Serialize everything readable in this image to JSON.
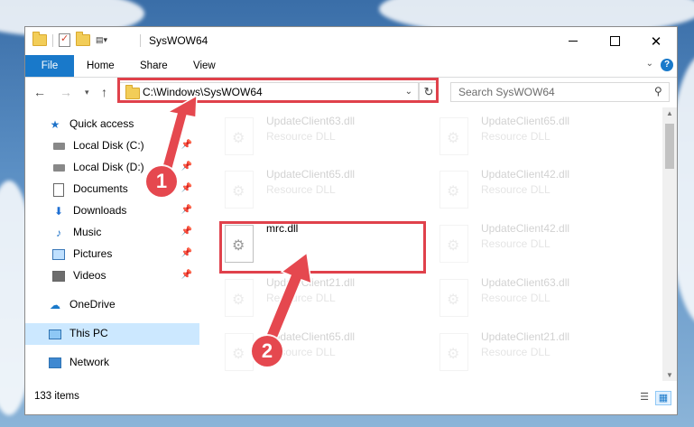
{
  "window": {
    "title": "SysWOW64"
  },
  "ribbon": {
    "tabs": [
      "File",
      "Home",
      "Share",
      "View"
    ],
    "help_label": "?"
  },
  "address_bar": {
    "path": "C:\\Windows\\SysWOW64",
    "search_placeholder": "Search SysWOW64"
  },
  "nav_pane": {
    "items": [
      {
        "label": "Quick access",
        "icon": "star-icon"
      },
      {
        "label": "Local Disk (C:)",
        "icon": "disk-icon",
        "pinned": true
      },
      {
        "label": "Local Disk (D:)",
        "icon": "disk-icon",
        "pinned": true
      },
      {
        "label": "Documents",
        "icon": "documents-icon",
        "pinned": true
      },
      {
        "label": "Downloads",
        "icon": "download-icon",
        "pinned": true
      },
      {
        "label": "Music",
        "icon": "music-icon",
        "pinned": true
      },
      {
        "label": "Pictures",
        "icon": "pictures-icon",
        "pinned": true
      },
      {
        "label": "Videos",
        "icon": "videos-icon",
        "pinned": true
      },
      {
        "label": "OneDrive",
        "icon": "cloud-icon"
      },
      {
        "label": "This PC",
        "icon": "computer-icon",
        "selected": true
      },
      {
        "label": "Network",
        "icon": "network-icon"
      }
    ]
  },
  "files": [
    {
      "name": "UpdateClient63.dll",
      "type": "Resource DLL",
      "faded": true
    },
    {
      "name": "UpdateClient65.dll",
      "type": "Resource DLL",
      "faded": true
    },
    {
      "name": "UpdateClient65.dll",
      "type": "Resource DLL",
      "faded": true
    },
    {
      "name": "UpdateClient42.dll",
      "type": "Resource DLL",
      "faded": true
    },
    {
      "name": "mrc.dll",
      "type": "",
      "faded": false
    },
    {
      "name": "UpdateClient42.dll",
      "type": "Resource DLL",
      "faded": true
    },
    {
      "name": "UpdateClient21.dll",
      "type": "Resource DLL",
      "faded": true
    },
    {
      "name": "UpdateClient63.dll",
      "type": "Resource DLL",
      "faded": true
    },
    {
      "name": "UpdateClient65.dll",
      "type": "Resource DLL",
      "faded": true
    },
    {
      "name": "UpdateClient21.dll",
      "type": "Resource DLL",
      "faded": true
    }
  ],
  "status_bar": {
    "item_count": "133 items"
  },
  "annotations": {
    "step1": "1",
    "step2": "2",
    "highlight_color": "#e0414b",
    "badge_color": "#e5484f"
  },
  "colors": {
    "accent": "#1979ca",
    "selected_bg": "#cce8ff"
  }
}
